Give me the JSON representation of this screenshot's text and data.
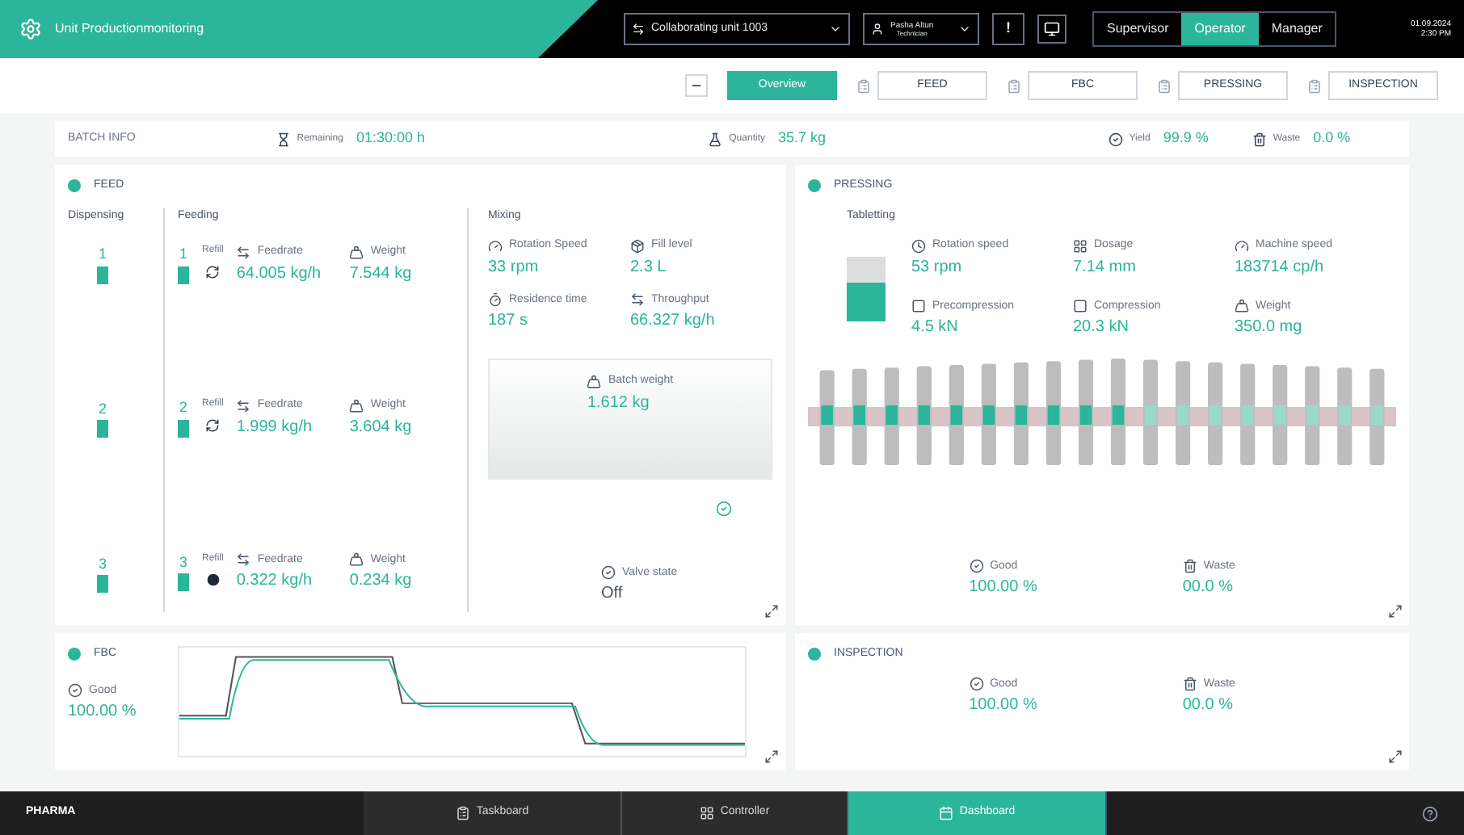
{
  "header": {
    "title": "Unit Productionmonitoring",
    "unit_selector": "Collaborating unit 1003",
    "user": {
      "name": "Pasha Altun",
      "role": "Technician"
    },
    "alert": "!",
    "roles": [
      {
        "label": "Supervisor",
        "selected": false
      },
      {
        "label": "Operator",
        "selected": true
      },
      {
        "label": "Manager",
        "selected": false
      }
    ],
    "date": "01.09.2024",
    "time": "2:30 PM"
  },
  "nav": [
    {
      "label": "Overview",
      "selected": true
    },
    {
      "label": "FEED",
      "selected": false
    },
    {
      "label": "FBC",
      "selected": false
    },
    {
      "label": "PRESSING",
      "selected": false
    },
    {
      "label": "INSPECTION",
      "selected": false
    }
  ],
  "batch_info": {
    "title": "BATCH INFO",
    "metrics": [
      {
        "label": "Remaining",
        "value": "01:30:00 h"
      },
      {
        "label": "Quantity",
        "value": "35.7 kg"
      },
      {
        "label": "Yield",
        "value": "99.9 %"
      },
      {
        "label": "Waste",
        "value": "0.0 %"
      }
    ]
  },
  "feed": {
    "title": "FEED",
    "dispensing_heading": "Dispensing",
    "feeding_heading": "Feeding",
    "mixing_heading": "Mixing",
    "dispensers": [
      "1",
      "2",
      "3"
    ],
    "feeders": [
      {
        "number": "1",
        "refill": "Refill",
        "kind": "cycle",
        "feedrate_label": "Feedrate",
        "feedrate": "64.005 kg/h",
        "weight_label": "Weight",
        "weight": "7.544 kg"
      },
      {
        "number": "2",
        "refill": "Refill",
        "kind": "cycle",
        "feedrate_label": "Feedrate",
        "feedrate": "1.999 kg/h",
        "weight_label": "Weight",
        "weight": "3.604 kg"
      },
      {
        "number": "3",
        "refill": "Refill",
        "kind": "dot",
        "feedrate_label": "Feedrate",
        "feedrate": "0.322 kg/h",
        "weight_label": "Weight",
        "weight": "0.234 kg"
      }
    ],
    "mixing": [
      {
        "label": "Rotation Speed",
        "value": "33 rpm"
      },
      {
        "label": "Fill level",
        "value": "2.3 L"
      },
      {
        "label": "Residence time",
        "value": "187 s"
      },
      {
        "label": "Throughput",
        "value": "66.327 kg/h"
      }
    ],
    "mixer_weight": {
      "label": "Batch weight",
      "value": "1.612 kg"
    },
    "valve": {
      "label": "Valve state",
      "value": "Off"
    }
  },
  "pressing": {
    "title": "PRESSING",
    "heading": "Tabletting",
    "metrics": [
      {
        "label": "Rotation speed",
        "value": "53 rpm"
      },
      {
        "label": "Dosage",
        "value": "7.14 mm"
      },
      {
        "label": "Machine speed",
        "value": "183714 cp/h"
      },
      {
        "label": "Precompression",
        "value": "4.5 kN"
      },
      {
        "label": "Compression",
        "value": "20.3 kN"
      },
      {
        "label": "Weight",
        "value": "350.0 mg"
      }
    ],
    "totals": [
      {
        "label": "Good",
        "value": "100.00 %"
      },
      {
        "label": "Waste",
        "value": "00.0 %"
      }
    ]
  },
  "fbc": {
    "title": "FBC",
    "good": {
      "label": "Good",
      "value": "100.00 %"
    }
  },
  "inspection": {
    "title": "INSPECTION",
    "totals": [
      {
        "label": "Good",
        "value": "100.00 %"
      },
      {
        "label": "Waste",
        "value": "00.0 %"
      }
    ]
  },
  "footer": {
    "logo": "PHARMA",
    "tabs": [
      {
        "label": "Taskboard",
        "selected": false
      },
      {
        "label": "Controller",
        "selected": false
      },
      {
        "label": "Dashboard",
        "selected": true
      }
    ]
  }
}
